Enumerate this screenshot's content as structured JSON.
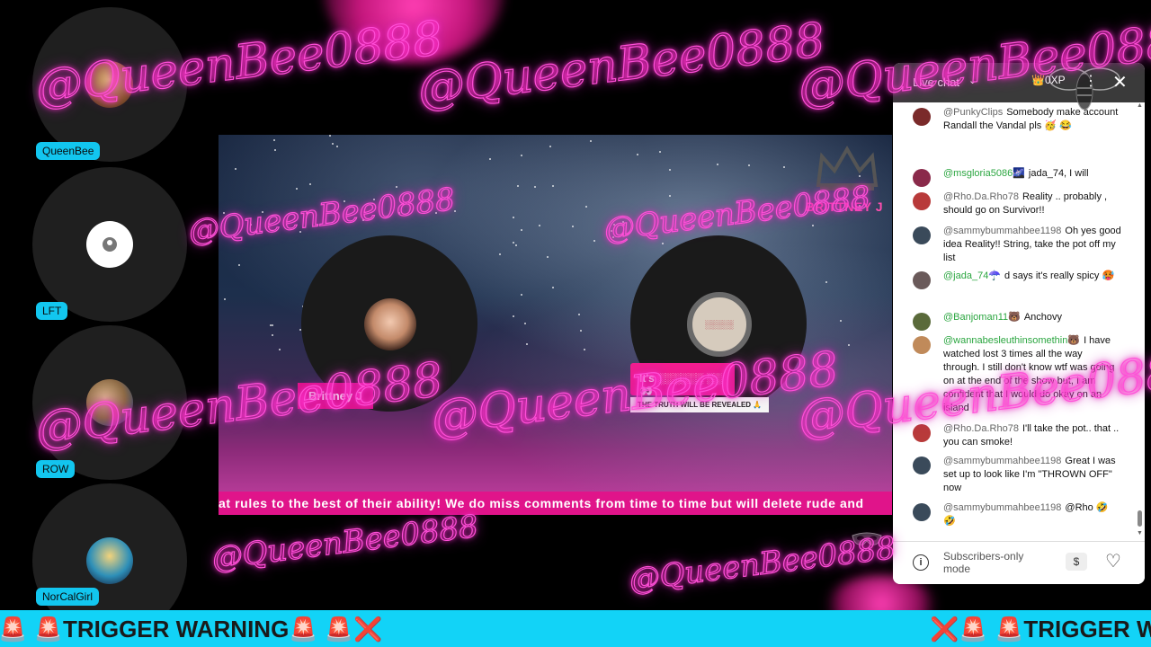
{
  "participants": [
    {
      "name": "QueenBee"
    },
    {
      "name": "LFT"
    },
    {
      "name": "ROW"
    },
    {
      "name": "NorCalGirl"
    }
  ],
  "stage": {
    "host_name": "Brittney J",
    "brand": "BRITTNEY J",
    "pink_card": "It's ░░░░░░ ░░ 👀",
    "truth_banner": "THE TRUTH WILL BE REVEALED 🙏",
    "logo_text": "░░░░░"
  },
  "ticker_pink": "at rules to the best of their ability! We do miss comments from time to time but will delete rude and",
  "ticker_cyan": {
    "left": "🚨 🚨TRIGGER WARNING🚨  🚨❌",
    "right": "❌🚨 🚨TRIGGER WA"
  },
  "watermark": "@QueenBee0888",
  "chat": {
    "title": "Live chat",
    "xp": "👑0XP",
    "messages": [
      {
        "author": "@PunkyClips",
        "text": "Somebody make account Randall the Vandal pls 🥳 😂",
        "author_green": false,
        "color": "#7a2a2a"
      },
      {
        "author": "@msgloria5086🌌",
        "text": "jada_74, I will",
        "author_green": true,
        "color": "#8a2a4a"
      },
      {
        "author": "@Rho.Da.Rho78",
        "text": "Reality .. probably , should go on Survivor!!",
        "author_green": false,
        "color": "#b83a3a"
      },
      {
        "author": "@sammybummahbee1198",
        "text": "Oh yes good idea Reality!! String, take the pot off my list",
        "author_green": false,
        "color": "#3a4a5a"
      },
      {
        "author": "@jada_74☂️",
        "text": "d says it's really spicy 🥵",
        "author_green": true,
        "color": "#6a5a5a"
      },
      {
        "author": "@Banjoman11🐻",
        "text": "Anchovy",
        "author_green": true,
        "color": "#5a6a3a"
      },
      {
        "author": "@wannabesleuthinsomethin🐻",
        "text": "I have watched lost 3 times all the way through. I still don't know wtf was going on at the end of the show but, I am confident that I would do okay on an island",
        "author_green": true,
        "color": "#c08a5a"
      },
      {
        "author": "@Rho.Da.Rho78",
        "text": "I'll take the pot.. that .. you can smoke!",
        "author_green": false,
        "color": "#b83a3a"
      },
      {
        "author": "@sammybummahbee1198",
        "text": "Great I was set up to look like I'm \"THROWN OFF\" now",
        "author_green": false,
        "color": "#3a4a5a"
      },
      {
        "author": "@sammybummahbee1198",
        "text": "@Rho 🤣 🤣",
        "author_green": false,
        "color": "#3a4a5a"
      }
    ],
    "footer_text": "Subscribers-only mode"
  }
}
